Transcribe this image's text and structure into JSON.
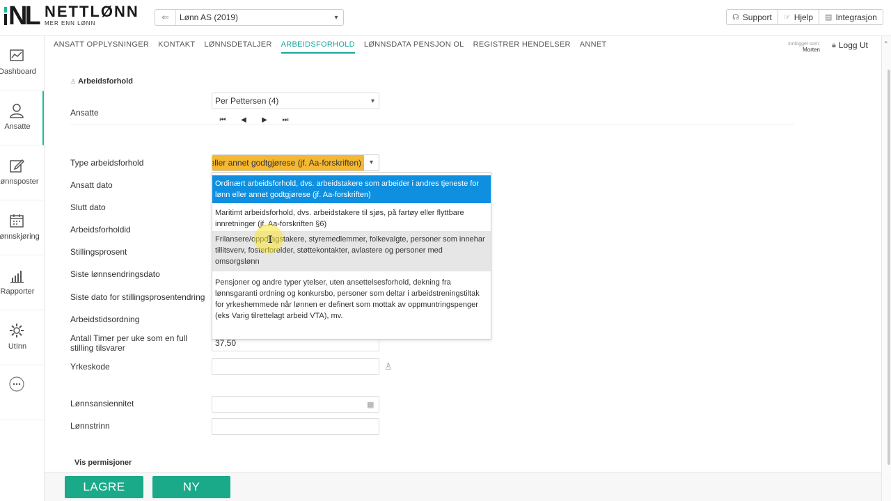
{
  "app": {
    "brand_name": "NETTLØNN",
    "brand_tagline": "MER ENN LØNN",
    "logo_letters": "NL",
    "company_selector_value": "Lønn AS (2019)"
  },
  "top_buttons": {
    "support": "Support",
    "help": "Hjelp",
    "integration": "Integrasjon"
  },
  "sidebar": {
    "items": [
      {
        "label": "Dashboard",
        "icon": "dashboard-icon"
      },
      {
        "label": "Ansatte",
        "icon": "user-icon"
      },
      {
        "label": "Lønnsposter",
        "icon": "edit-icon"
      },
      {
        "label": "Lønnskjøring",
        "icon": "calendar-icon"
      },
      {
        "label": "Rapporter",
        "icon": "bar-chart-icon"
      },
      {
        "label": "UtInn",
        "icon": "gear-icon"
      }
    ]
  },
  "tabs": [
    {
      "label": "ANSATT OPPLYSNINGER"
    },
    {
      "label": "KONTAKT"
    },
    {
      "label": "LØNNSDETALJER"
    },
    {
      "label": "ARBEIDSFORHOLD",
      "active": true
    },
    {
      "label": "LØNNSDATA PENSJON OL"
    },
    {
      "label": "REGISTRER HENDELSER"
    },
    {
      "label": "ANNET"
    }
  ],
  "session": {
    "logged_in_label": "Innlogget som:",
    "user": "Morten",
    "logout": "Logg Ut"
  },
  "form": {
    "section_title": "Arbeidsforhold",
    "employees_label": "Ansatte",
    "employee_value": "Per Pettersen  (4)",
    "type_label": "Type arbeidsforhold",
    "type_value": "Ordinært arbeidsforhold, dvs. arbeidstakere som arbeider i andres tjeneste for lønn eller annet godtgjørese (jf. Aa-forskriften)",
    "start_date_label": "Ansatt dato",
    "end_date_label": "Slutt dato",
    "employment_id_label": "Arbeidsforholdid",
    "position_pct_label": "Stillingsprosent",
    "last_salary_change_label": "Siste lønnsendringsdato",
    "last_pct_change_label": "Siste dato for stillingsprosentendring",
    "working_time_label": "Arbeidstidsordning",
    "hours_per_week_label": "Antall Timer per uke som en full stilling tilsvarer",
    "hours_per_week_value": "37,50",
    "occupation_code_label": "Yrkeskode",
    "seniority_label": "Lønnsansiennitet",
    "salary_step_label": "Lønnstrinn",
    "show_leave_label": "Vis permisjoner"
  },
  "dropdown_options": [
    {
      "text": "Ordinært arbeidsforhold, dvs. arbeidstakere som arbeider i andres tjeneste for lønn eller annet godtgjørese (jf. Aa-forskriften)"
    },
    {
      "text": "Maritimt arbeidsforhold, dvs. arbeidstakere til sjøs, på fartøy eller flyttbare innretninger (jf. Aa-forskriften §6)"
    },
    {
      "text": "Frilansere/oppdragstakere, styremedlemmer, folkevalgte, personer som innehar tillitsverv, fosterforelder, støttekontakter, avlastere og personer med omsorgslønn"
    },
    {
      "text": "Pensjoner og andre typer ytelser, uten ansettelsesforhold, dekning fra lønnsgaranti ordning og konkursbo, personer som deltar i arbeidstreningstiltak for yrkeshemmede når lønnen er definert som mottak av oppmuntringspenger (eks Varig tilrettelagt arbeid VTA), mv."
    }
  ],
  "actions": {
    "save": "LAGRE",
    "new": "NY"
  },
  "colors": {
    "accent": "#1abc9c",
    "button": "#1aaa8a",
    "highlight_select": "#f5b832",
    "option_selected": "#0e8fe0"
  }
}
